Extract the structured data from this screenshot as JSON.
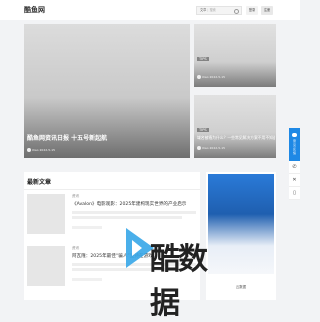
{
  "header": {
    "logo": "酷鱼网",
    "search_category": "文章",
    "search_separator": "|",
    "search_placeholder": "搜索",
    "login_label": "登录",
    "register_label": "注册"
  },
  "banner": {
    "main": {
      "title": "酷鱼网资讯日报 十五号新起航",
      "date": "Xiao 2022-5-15"
    },
    "side": [
      {
        "tag": "TIPS",
        "title": "",
        "date": "Xiao 2022-5-15"
      },
      {
        "tag": "TIPS",
        "title": "域名被墙为什么？一些常见解决方案不用不知道",
        "date": "Xiao 2022-5-15"
      }
    ]
  },
  "latest": {
    "heading": "最新文章",
    "articles": [
      {
        "category": "资讯",
        "title": "《Avalon》电影观影：2025年建构现实世界的产业启示"
      },
      {
        "category": "资讯",
        "title": "阿瓦隆：2025年最佳“骗人”坚持在游戏..."
      }
    ]
  },
  "sidebar": {
    "caption": "云数据"
  },
  "right_bar": {
    "feedback": "意见反馈",
    "icons": [
      "wechat-icon",
      "share-icon",
      "mobile-icon"
    ]
  },
  "watermark": {
    "text": "酷数据"
  }
}
